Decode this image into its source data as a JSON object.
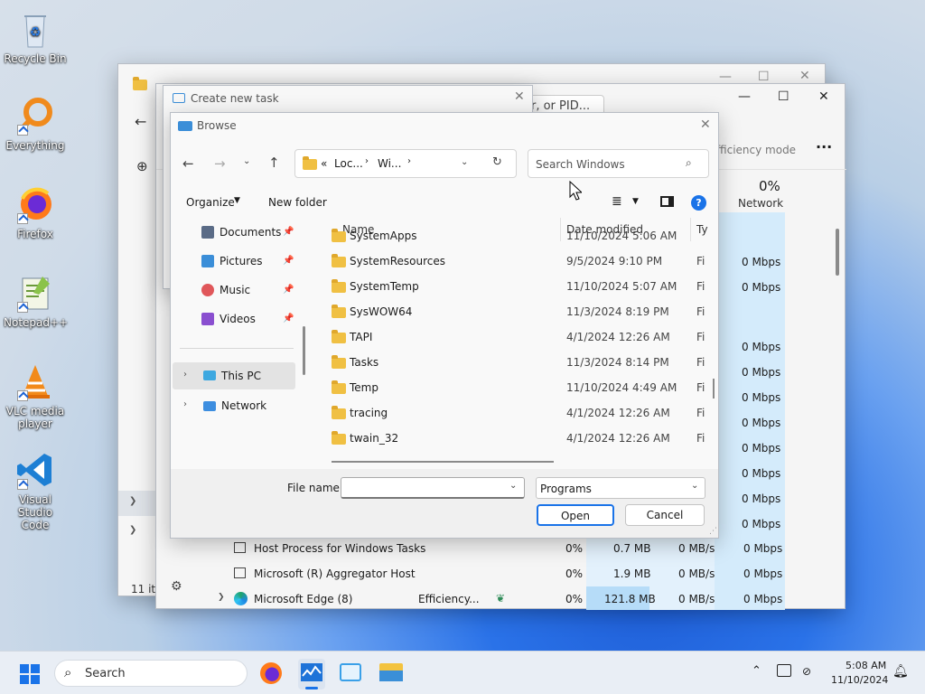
{
  "desktop": {
    "icons": [
      {
        "label": "Recycle Bin"
      },
      {
        "label": "Everything"
      },
      {
        "label": "Firefox"
      },
      {
        "label": "Notepad++"
      },
      {
        "label": "VLC media player"
      },
      {
        "label": "Visual Studio Code"
      }
    ]
  },
  "taskmgr": {
    "search_placeholder": "er, or PID...",
    "efficiency_mode_label": "fficiency mode",
    "network_pct": "0%",
    "network_label": "Network",
    "status_left": "11 ite",
    "rows_mbps": [
      "0 Mbps",
      "0 Mbps",
      "0 Mbps",
      "0 Mbps",
      "0 Mbps",
      "0 Mbps",
      "0 Mbps",
      "0 Mbps",
      "0 Mbps",
      "0 Mbps"
    ],
    "processes": [
      {
        "name": "Host Process for Windows Tasks",
        "status": "",
        "cpu": "0%",
        "mem": "0.7 MB",
        "disk": "0 MB/s",
        "net": "0 Mbps"
      },
      {
        "name": "Microsoft (R) Aggregator Host",
        "status": "",
        "cpu": "0%",
        "mem": "1.9 MB",
        "disk": "0 MB/s",
        "net": "0 Mbps"
      },
      {
        "name": "Microsoft Edge (8)",
        "status": "Efficiency...",
        "cpu": "0%",
        "mem": "121.8 MB",
        "disk": "0 MB/s",
        "net": "0 Mbps"
      }
    ]
  },
  "createtask": {
    "title": "Create new task"
  },
  "browse": {
    "title": "Browse",
    "breadcrumb": {
      "sep": "«",
      "a": "Loc...",
      "b": "Wi..."
    },
    "search_placeholder": "Search Windows",
    "organize": "Organize",
    "new_folder": "New folder",
    "col_name": "Name",
    "col_date": "Date modified",
    "col_type": "Ty",
    "quick_access": [
      {
        "label": "Documents",
        "color": "#5a6b86"
      },
      {
        "label": "Pictures",
        "color": "#3b8ed8"
      },
      {
        "label": "Music",
        "color": "#e0575a"
      },
      {
        "label": "Videos",
        "color": "#8a4fd0"
      }
    ],
    "this_pc": "This PC",
    "network": "Network",
    "partial_top": "SystemApps",
    "partial_top_date": "11/10/2024 5:06 AM",
    "files": [
      {
        "name": "SystemResources",
        "date": "9/5/2024 9:10 PM",
        "type": "Fi"
      },
      {
        "name": "SystemTemp",
        "date": "11/10/2024 5:07 AM",
        "type": "Fi"
      },
      {
        "name": "SysWOW64",
        "date": "11/3/2024 8:19 PM",
        "type": "Fi"
      },
      {
        "name": "TAPI",
        "date": "4/1/2024 12:26 AM",
        "type": "Fi"
      },
      {
        "name": "Tasks",
        "date": "11/3/2024 8:14 PM",
        "type": "Fi"
      },
      {
        "name": "Temp",
        "date": "11/10/2024 4:49 AM",
        "type": "Fi"
      },
      {
        "name": "tracing",
        "date": "4/1/2024 12:26 AM",
        "type": "Fi"
      },
      {
        "name": "twain_32",
        "date": "4/1/2024 12:26 AM",
        "type": "Fi"
      }
    ],
    "file_name_label": "File name:",
    "file_name_value": "",
    "file_type": "Programs",
    "open": "Open",
    "cancel": "Cancel"
  },
  "taskbar": {
    "search": "Search",
    "time": "5:08 AM",
    "date": "11/10/2024"
  }
}
